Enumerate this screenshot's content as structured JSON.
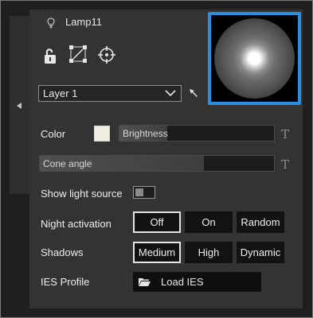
{
  "header": {
    "title": "Lamp11"
  },
  "icons": {
    "lamp": "lightbulb-icon",
    "unlock": "unlock-icon",
    "scale": "scale-handles-icon",
    "target": "crosshair-icon",
    "collapse": "collapse-arrow-icon",
    "picker": "cursor-arrow-icon"
  },
  "layer": {
    "selected": "Layer 1"
  },
  "color": {
    "label": "Color",
    "swatch": "#efece0",
    "brightness_label": "Brightness",
    "brightness_level": 0.31
  },
  "cone": {
    "label": "Cone angle",
    "level": 0.7
  },
  "show_source": {
    "label": "Show light source",
    "enabled": false
  },
  "night": {
    "label": "Night activation",
    "options": [
      "Off",
      "On",
      "Random"
    ],
    "selected": "Off"
  },
  "shadows": {
    "label": "Shadows",
    "options": [
      "Medium",
      "High",
      "Dynamic"
    ],
    "selected": "Medium"
  },
  "ies": {
    "label": "IES Profile",
    "button": "Load IES"
  },
  "t_glyph": "T",
  "colors": {
    "accent": "#2a8fe0",
    "panel": "#333333",
    "background": "#1f1f1f"
  }
}
